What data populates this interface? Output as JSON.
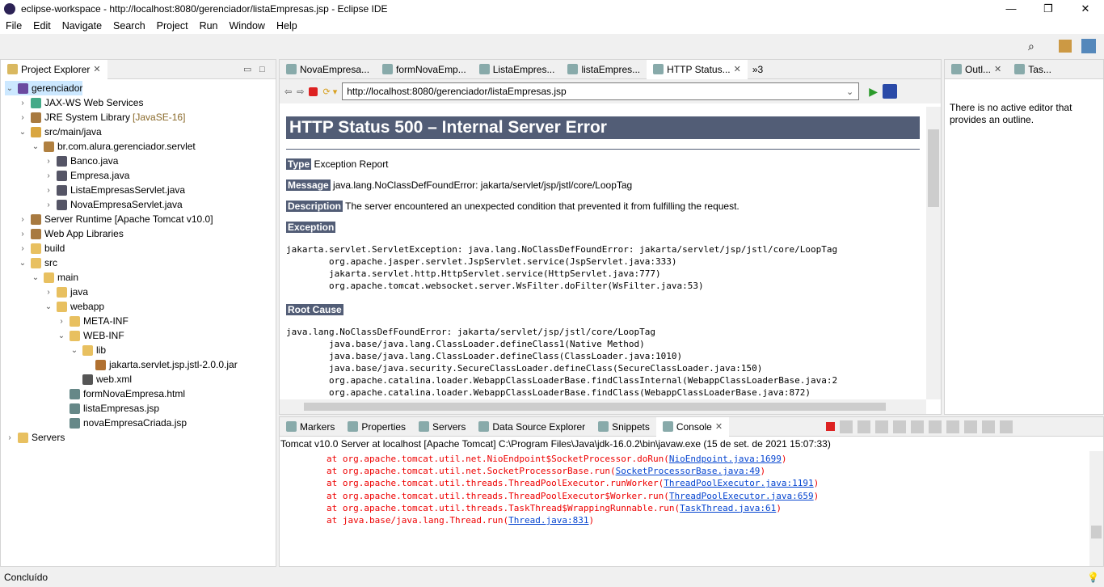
{
  "window": {
    "title": "eclipse-workspace - http://localhost:8080/gerenciador/listaEmpresas.jsp - Eclipse IDE",
    "minimize": "—",
    "maximize": "❐",
    "close": "✕"
  },
  "menu": [
    "File",
    "Edit",
    "Navigate",
    "Search",
    "Project",
    "Run",
    "Window",
    "Help"
  ],
  "project_explorer": {
    "title": "Project Explorer",
    "items": [
      {
        "label": "gerenciador",
        "depth": 0,
        "state": "open",
        "icon": "project-icon"
      },
      {
        "label": "JAX-WS Web Services",
        "depth": 1,
        "state": "closed",
        "icon": "webservice-icon"
      },
      {
        "label": "JRE System Library",
        "deco": "[JavaSE-16]",
        "depth": 1,
        "state": "closed",
        "icon": "library-icon"
      },
      {
        "label": "src/main/java",
        "depth": 1,
        "state": "open",
        "icon": "source-folder-icon"
      },
      {
        "label": "br.com.alura.gerenciador.servlet",
        "depth": 2,
        "state": "open",
        "icon": "package-icon"
      },
      {
        "label": "Banco.java",
        "depth": 3,
        "state": "closed",
        "icon": "java-file-icon"
      },
      {
        "label": "Empresa.java",
        "depth": 3,
        "state": "closed",
        "icon": "java-file-icon"
      },
      {
        "label": "ListaEmpresasServlet.java",
        "depth": 3,
        "state": "closed",
        "icon": "java-file-icon"
      },
      {
        "label": "NovaEmpresaServlet.java",
        "depth": 3,
        "state": "closed",
        "icon": "java-file-icon"
      },
      {
        "label": "Server Runtime [Apache Tomcat v10.0]",
        "depth": 1,
        "state": "closed",
        "icon": "library-icon"
      },
      {
        "label": "Web App Libraries",
        "depth": 1,
        "state": "closed",
        "icon": "library-icon"
      },
      {
        "label": "build",
        "depth": 1,
        "state": "closed",
        "icon": "folder-icon"
      },
      {
        "label": "src",
        "depth": 1,
        "state": "open",
        "icon": "folder-icon"
      },
      {
        "label": "main",
        "depth": 2,
        "state": "open",
        "icon": "folder-icon"
      },
      {
        "label": "java",
        "depth": 3,
        "state": "closed",
        "icon": "folder-icon"
      },
      {
        "label": "webapp",
        "depth": 3,
        "state": "open",
        "icon": "folder-icon"
      },
      {
        "label": "META-INF",
        "depth": 4,
        "state": "closed",
        "icon": "folder-icon"
      },
      {
        "label": "WEB-INF",
        "depth": 4,
        "state": "open",
        "icon": "folder-icon"
      },
      {
        "label": "lib",
        "depth": 5,
        "state": "open",
        "icon": "folder-icon"
      },
      {
        "label": "jakarta.servlet.jsp.jstl-2.0.0.jar",
        "depth": 6,
        "state": "leaf",
        "icon": "jar-icon"
      },
      {
        "label": "web.xml",
        "depth": 5,
        "state": "leaf",
        "icon": "xml-file-icon"
      },
      {
        "label": "formNovaEmpresa.html",
        "depth": 4,
        "state": "leaf",
        "icon": "html-file-icon"
      },
      {
        "label": "listaEmpresas.jsp",
        "depth": 4,
        "state": "leaf",
        "icon": "jsp-file-icon"
      },
      {
        "label": "novaEmpresaCriada.jsp",
        "depth": 4,
        "state": "leaf",
        "icon": "jsp-file-icon"
      },
      {
        "label": "Servers",
        "depth": 0,
        "state": "closed",
        "icon": "folder-icon"
      }
    ]
  },
  "editor": {
    "tabs": [
      {
        "label": "NovaEmpresa..."
      },
      {
        "label": "formNovaEmp..."
      },
      {
        "label": "ListaEmpres..."
      },
      {
        "label": "listaEmpres..."
      },
      {
        "label": "HTTP Status...",
        "active": true
      }
    ],
    "overflow": "»3",
    "url": "http://localhost:8080/gerenciador/listaEmpresas.jsp",
    "page": {
      "heading": "HTTP Status 500 – Internal Server Error",
      "type_label": "Type",
      "type_value": "Exception Report",
      "message_label": "Message",
      "message_value": "java.lang.NoClassDefFoundError: jakarta/servlet/jsp/jstl/core/LoopTag",
      "description_label": "Description",
      "description_value": "The server encountered an unexpected condition that prevented it from fulfilling the request.",
      "exception_label": "Exception",
      "exception_trace": "jakarta.servlet.ServletException: java.lang.NoClassDefFoundError: jakarta/servlet/jsp/jstl/core/LoopTag\n\torg.apache.jasper.servlet.JspServlet.service(JspServlet.java:333)\n\tjakarta.servlet.http.HttpServlet.service(HttpServlet.java:777)\n\torg.apache.tomcat.websocket.server.WsFilter.doFilter(WsFilter.java:53)",
      "root_cause_label": "Root Cause",
      "root_cause_trace": "java.lang.NoClassDefFoundError: jakarta/servlet/jsp/jstl/core/LoopTag\n\tjava.base/java.lang.ClassLoader.defineClass1(Native Method)\n\tjava.base/java.lang.ClassLoader.defineClass(ClassLoader.java:1010)\n\tjava.base/java.security.SecureClassLoader.defineClass(SecureClassLoader.java:150)\n\torg.apache.catalina.loader.WebappClassLoaderBase.findClassInternal(WebappClassLoaderBase.java:2\n\torg.apache.catalina.loader.WebappClassLoaderBase.findClass(WebappClassLoaderBase.java:872)"
    }
  },
  "outline": {
    "tabs": [
      {
        "label": "Outl..."
      },
      {
        "label": "Tas..."
      }
    ],
    "message": "There is no active editor that provides an outline."
  },
  "bottom": {
    "tabs": [
      {
        "label": "Markers"
      },
      {
        "label": "Properties"
      },
      {
        "label": "Servers"
      },
      {
        "label": "Data Source Explorer"
      },
      {
        "label": "Snippets"
      },
      {
        "label": "Console",
        "active": true
      }
    ],
    "console_header": "Tomcat v10.0 Server at localhost [Apache Tomcat] C:\\Program Files\\Java\\jdk-16.0.2\\bin\\javaw.exe  (15 de set. de 2021 15:07:33)",
    "lines": [
      {
        "text": "at org.apache.tomcat.util.net.NioEndpoint$SocketProcessor.doRun(",
        "link": "NioEndpoint.java:1699",
        "end": ")"
      },
      {
        "text": "at org.apache.tomcat.util.net.SocketProcessorBase.run(",
        "link": "SocketProcessorBase.java:49",
        "end": ")"
      },
      {
        "text": "at org.apache.tomcat.util.threads.ThreadPoolExecutor.runWorker(",
        "link": "ThreadPoolExecutor.java:1191",
        "end": ")"
      },
      {
        "text": "at org.apache.tomcat.util.threads.ThreadPoolExecutor$Worker.run(",
        "link": "ThreadPoolExecutor.java:659",
        "end": ")"
      },
      {
        "text": "at org.apache.tomcat.util.threads.TaskThread$WrappingRunnable.run(",
        "link": "TaskThread.java:61",
        "end": ")"
      },
      {
        "text": "at java.base/java.lang.Thread.run(",
        "link": "Thread.java:831",
        "end": ")"
      }
    ]
  },
  "status": {
    "text": "Concluído"
  },
  "colors": {
    "error_heading_bg": "#525D76",
    "console_error": "#e00000",
    "link": "#0645d0"
  }
}
